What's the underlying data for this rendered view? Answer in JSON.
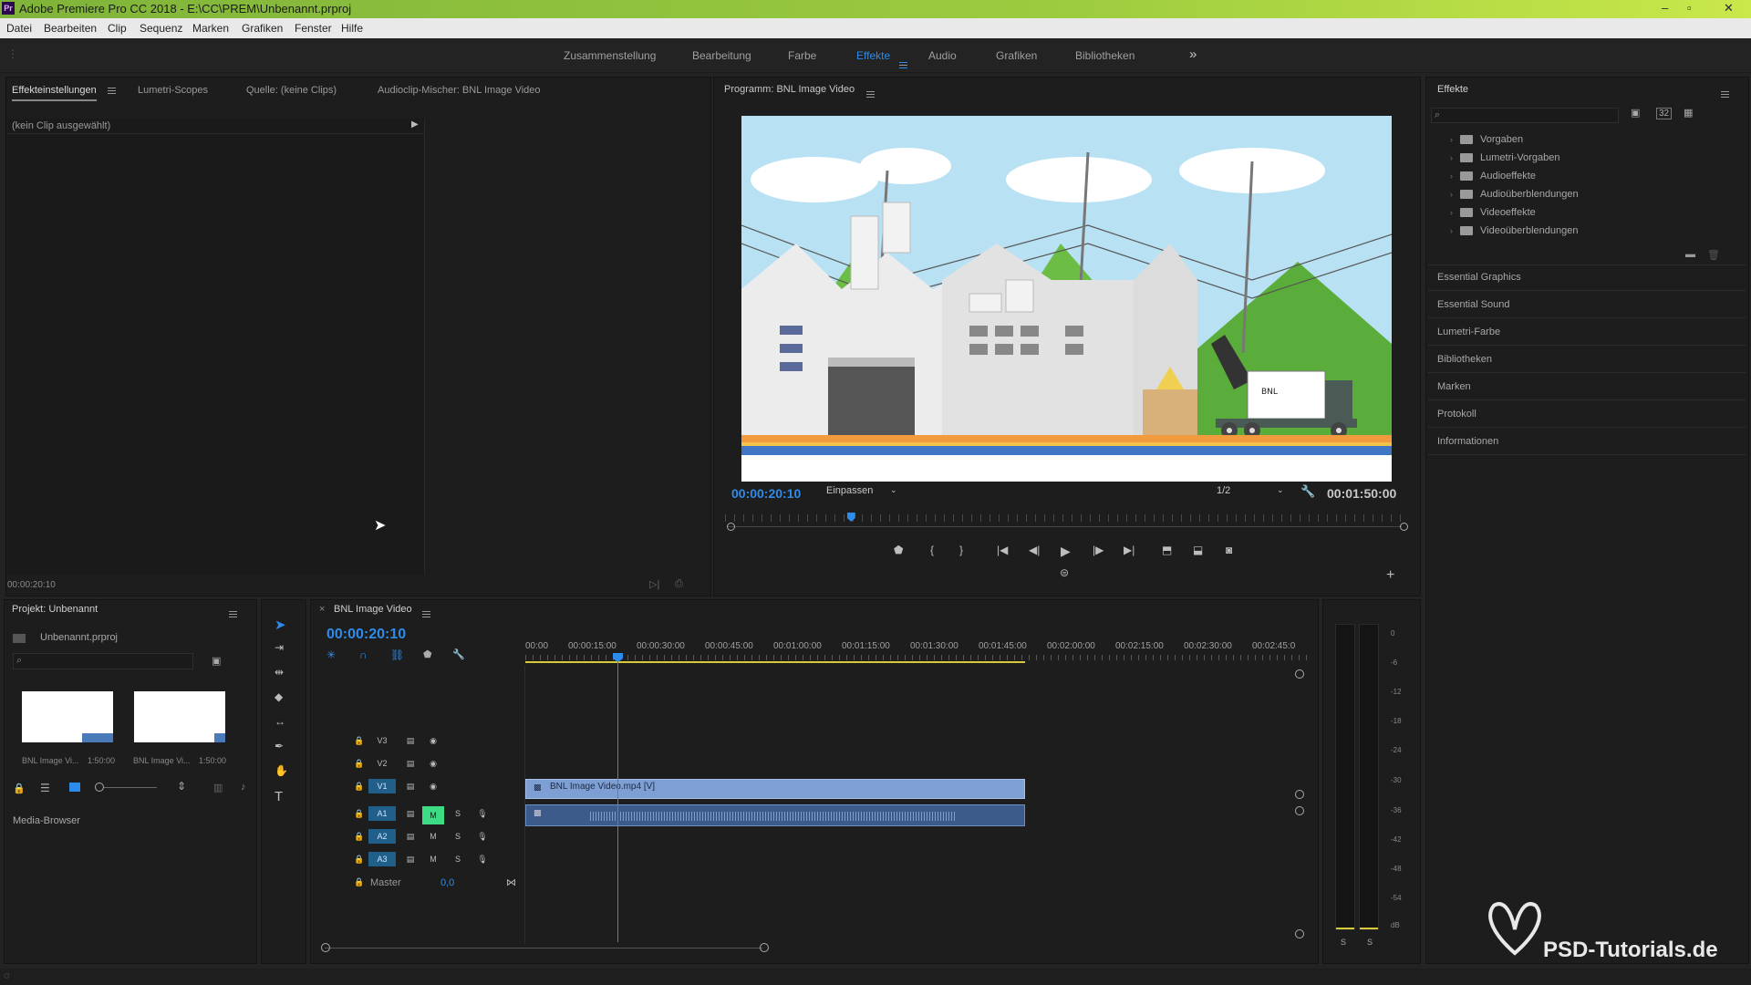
{
  "app": {
    "title": "Adobe Premiere Pro CC 2018 - E:\\CC\\PREM\\Unbenannt.prproj",
    "logo": "Pr"
  },
  "menu": [
    "Datei",
    "Bearbeiten",
    "Clip",
    "Sequenz",
    "Marken",
    "Grafiken",
    "Fenster",
    "Hilfe"
  ],
  "workspaces": {
    "items": [
      "Zusammenstellung",
      "Bearbeitung",
      "Farbe",
      "Effekte",
      "Audio",
      "Grafiken",
      "Bibliotheken"
    ],
    "active": "Effekte",
    "more": "»"
  },
  "source_panel": {
    "tabs": [
      "Effekteinstellungen",
      "Lumetri-Scopes",
      "Quelle: (keine Clips)",
      "Audioclip-Mischer: BNL Image Video"
    ],
    "no_clip": "(kein Clip ausgewählt)",
    "timecode": "00:00:20:10"
  },
  "program_monitor": {
    "title": "Programm: BNL Image Video",
    "timecode": "00:00:20:10",
    "fit": "Einpassen",
    "resolution": "1/2",
    "duration": "00:01:50:00",
    "truck_text": "BNL",
    "playhead_fraction": 0.185
  },
  "project_panel": {
    "title": "Projekt: Unbenannt",
    "file": "Unbenannt.prproj",
    "thumbs": [
      {
        "label": "BNL Image Vi...",
        "duration": "1:50:00"
      },
      {
        "label": "BNL Image Vi...",
        "duration": "1:50:00"
      }
    ],
    "media_browser": "Media-Browser"
  },
  "timeline": {
    "sequence": "BNL Image Video",
    "timecode": "00:00:20:10",
    "ruler": [
      "00:00",
      "00:00:15:00",
      "00:00:30:00",
      "00:00:45:00",
      "00:01:00:00",
      "00:01:15:00",
      "00:01:30:00",
      "00:01:45:00",
      "00:02:00:00",
      "00:02:15:00",
      "00:02:30:00",
      "00:02:45:0"
    ],
    "video_tracks": [
      "V3",
      "V2",
      "V1"
    ],
    "audio_tracks": [
      "A1",
      "A2",
      "A3"
    ],
    "master": "Master",
    "master_value": "0,0",
    "clip_name": "BNL Image Video.mp4 [V]",
    "m": "M",
    "s": "S"
  },
  "effects_panel": {
    "title": "Effekte",
    "folders": [
      "Vorgaben",
      "Lumetri-Vorgaben",
      "Audioeffekte",
      "Audioüberblendungen",
      "Videoeffekte",
      "Videoüberblendungen"
    ],
    "icon_32": "32",
    "sections": [
      "Essential Graphics",
      "Essential Sound",
      "Lumetri-Farbe",
      "Bibliotheken",
      "Marken",
      "Protokoll",
      "Informationen"
    ]
  },
  "audio_meter": {
    "ticks": [
      "0",
      "-6",
      "-12",
      "-18",
      "-24",
      "-30",
      "-36",
      "-42",
      "-48",
      "-54",
      "dB"
    ],
    "solo": [
      "S",
      "S"
    ]
  },
  "watermark": "PSD-Tutorials.de",
  "colors": {
    "accent": "#2d8ceb",
    "title_green": "#9ccb3f",
    "clip_blue": "#6b8fc7",
    "audio_clip": "#4a6a9a",
    "active_m": "#3ddc84",
    "track_blue": "#1f5f8a"
  }
}
